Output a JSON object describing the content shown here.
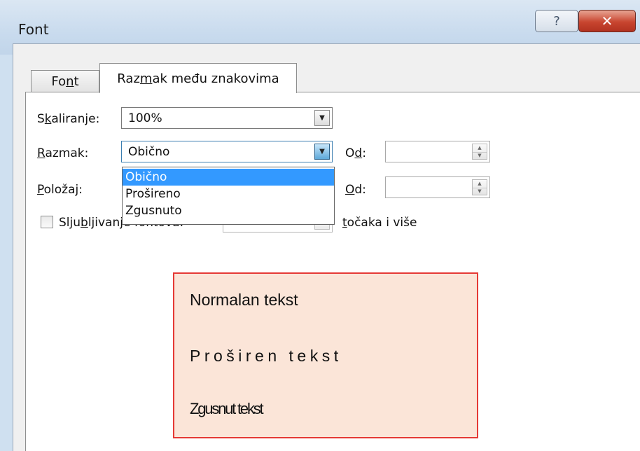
{
  "window": {
    "title": "Font"
  },
  "title_buttons": {
    "help": "?",
    "close": "✕"
  },
  "tabs": [
    {
      "label": "Font",
      "active": false,
      "accel_index": 2
    },
    {
      "label": "Razmak među znakovima",
      "active": true,
      "accel_index": 3
    }
  ],
  "fields": {
    "scaling": {
      "label": "Skaliranje:",
      "accel_index": 1,
      "value": "100%"
    },
    "spacing": {
      "label": "Razmak:",
      "accel_index": 0,
      "value": "Obično",
      "by_label": "Od:",
      "by_accel_index": 1,
      "by_value": ""
    },
    "position": {
      "label": "Položaj:",
      "accel_index": 0,
      "by_label": "Od:",
      "by_accel_index": 0,
      "by_value": ""
    },
    "kerning": {
      "label": "Sljubljivanje fontova:",
      "accel_index": 4,
      "checked": false,
      "value": "",
      "suffix": "točaka i više",
      "suffix_accel_index": 0
    }
  },
  "dropdown": {
    "options": [
      "Obično",
      "Prošireno",
      "Zgusnuto"
    ],
    "selected": "Obično"
  },
  "callout": {
    "normal": "Normalan tekst",
    "expanded": "Proširen tekst",
    "condensed": "Zgusnut tekst",
    "border_color": "#e53935",
    "background": "#fbe5d8"
  },
  "icons": {
    "dropdown_arrow": "triangle-down",
    "spin_up": "triangle-up",
    "spin_down": "triangle-down"
  }
}
